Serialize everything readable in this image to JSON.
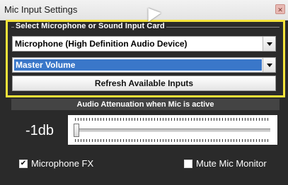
{
  "window": {
    "title": "Mic Input Settings",
    "close_icon": "close-icon"
  },
  "colors": {
    "highlight": "#f5e33a",
    "selection": "#3a77c9",
    "panel": "#2a2a2a"
  },
  "input_group": {
    "legend": "Select Microphone or Sound Input Card",
    "device_select": {
      "value": "Microphone (High Definition Audio Device)"
    },
    "channel_select": {
      "value": "Master Volume"
    },
    "refresh_label": "Refresh Available Inputs"
  },
  "attenuation": {
    "header": "Audio Attenuation when Mic is active",
    "value_text": "-1db",
    "slider_level": 0.0
  },
  "options": {
    "microphone_fx": {
      "label": "Microphone FX",
      "checked": true
    },
    "mute_monitor": {
      "label": "Mute Mic Monitor",
      "checked": false
    }
  }
}
